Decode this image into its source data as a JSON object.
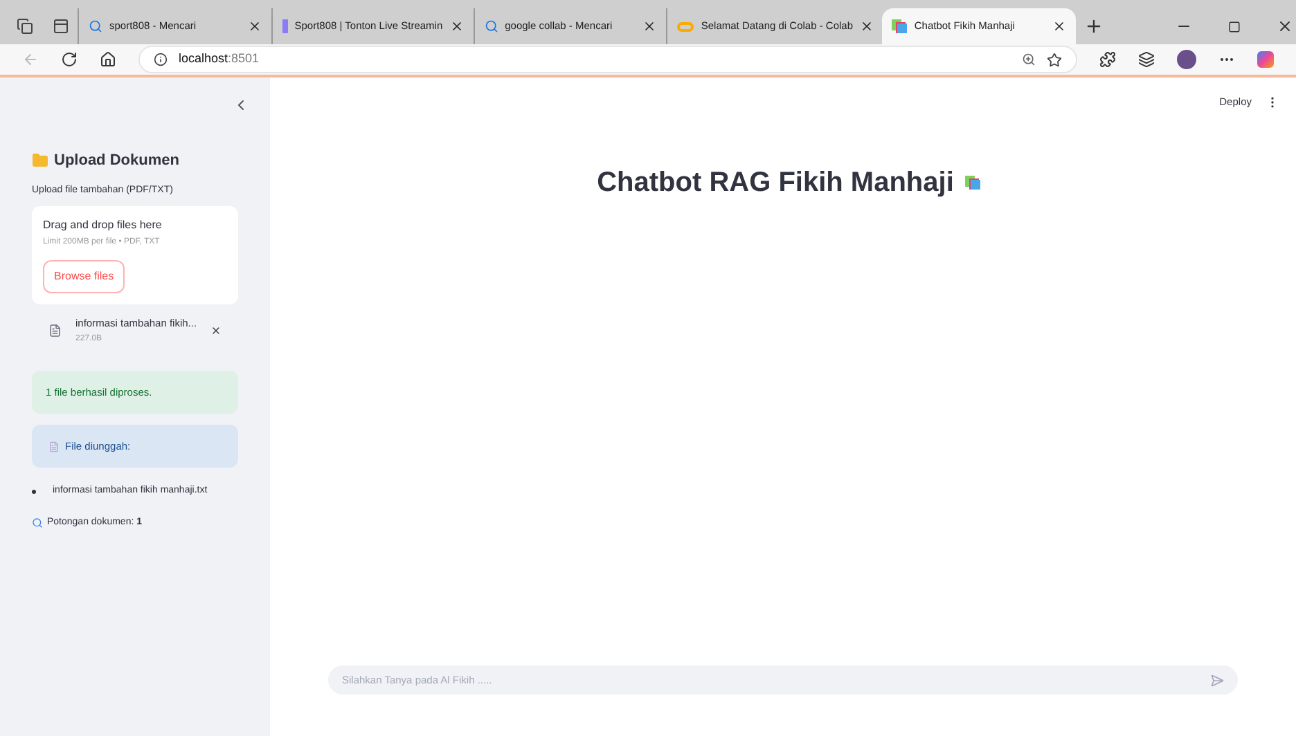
{
  "browser": {
    "tabs": [
      {
        "title": "sport808 - Mencari",
        "kind": "search",
        "selected": false
      },
      {
        "title": "Sport808 | Tonton Live Streamin",
        "kind": "site",
        "selected": false
      },
      {
        "title": "google collab - Mencari",
        "kind": "search",
        "selected": false
      },
      {
        "title": "Selamat Datang di Colab - Colab",
        "kind": "colab",
        "selected": false
      },
      {
        "title": "Chatbot Fikih Manhaji",
        "kind": "books",
        "selected": true
      }
    ],
    "address": {
      "host": "localhost",
      "port": ":8501"
    }
  },
  "header": {
    "deploy": "Deploy"
  },
  "sidebar": {
    "heading": "Upload Dokumen",
    "uploader_label": "Upload file tambahan (PDF/TXT)",
    "dropzone": {
      "title": "Drag and drop files here",
      "hint": "Limit 200MB per file • PDF, TXT",
      "button": "Browse files"
    },
    "file": {
      "name": "informasi tambahan fikih...",
      "size": "227.0B"
    },
    "success": "1 file berhasil diproses.",
    "info": "File diunggah:",
    "files": [
      "informasi tambahan fikih manhaji.txt"
    ],
    "chunks": {
      "label": "Potongan dokumen: ",
      "value": "1"
    }
  },
  "main": {
    "title": "Chatbot RAG Fikih Manhaji"
  },
  "chat_input": {
    "placeholder": "Silahkan Tanya pada Al Fikih ....."
  }
}
